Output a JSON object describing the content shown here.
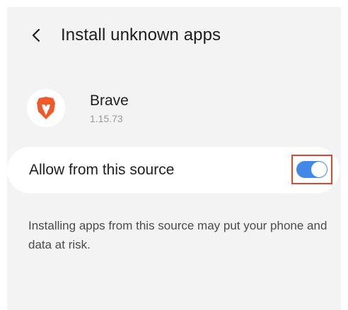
{
  "header": {
    "back_icon": "chevron-left-icon",
    "title": "Install unknown apps"
  },
  "app": {
    "icon": "brave-lion-icon",
    "name": "Brave",
    "version": "1.15.73"
  },
  "setting": {
    "label": "Allow from this source",
    "enabled": true,
    "accent_color": "#4188e8",
    "highlight_color": "#e2452a"
  },
  "warning": {
    "text": "Installing apps from this source may put your phone and data at risk."
  }
}
